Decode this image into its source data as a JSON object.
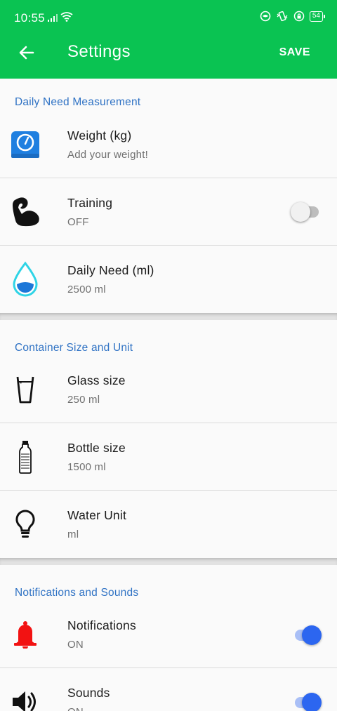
{
  "status_bar": {
    "time": "10:55",
    "battery": "54"
  },
  "app_bar": {
    "title": "Settings",
    "save_label": "SAVE"
  },
  "colors": {
    "primary": "#0ac352",
    "section_header": "#2f72c4",
    "switch_on": "#2c66f0",
    "bell": "#f21212",
    "scale": "#1f7fe0",
    "water": "#2fd4e6"
  },
  "sections": [
    {
      "header": "Daily Need Measurement",
      "items": [
        {
          "icon": "scale-icon",
          "title": "Weight (kg)",
          "subtitle": "Add your weight!"
        },
        {
          "icon": "muscle-icon",
          "title": "Training",
          "subtitle": "OFF",
          "toggle": false
        },
        {
          "icon": "water-drop-icon",
          "title": "Daily Need (ml)",
          "subtitle": "2500 ml"
        }
      ]
    },
    {
      "header": "Container Size and Unit",
      "items": [
        {
          "icon": "glass-icon",
          "title": "Glass size",
          "subtitle": "250 ml"
        },
        {
          "icon": "bottle-icon",
          "title": "Bottle size",
          "subtitle": "1500 ml"
        },
        {
          "icon": "lightbulb-icon",
          "title": "Water Unit",
          "subtitle": "ml"
        }
      ]
    },
    {
      "header": "Notifications and Sounds",
      "items": [
        {
          "icon": "bell-icon",
          "title": "Notifications",
          "subtitle": "ON",
          "toggle": true
        },
        {
          "icon": "speaker-icon",
          "title": "Sounds",
          "subtitle": "ON",
          "toggle": true
        }
      ]
    }
  ]
}
